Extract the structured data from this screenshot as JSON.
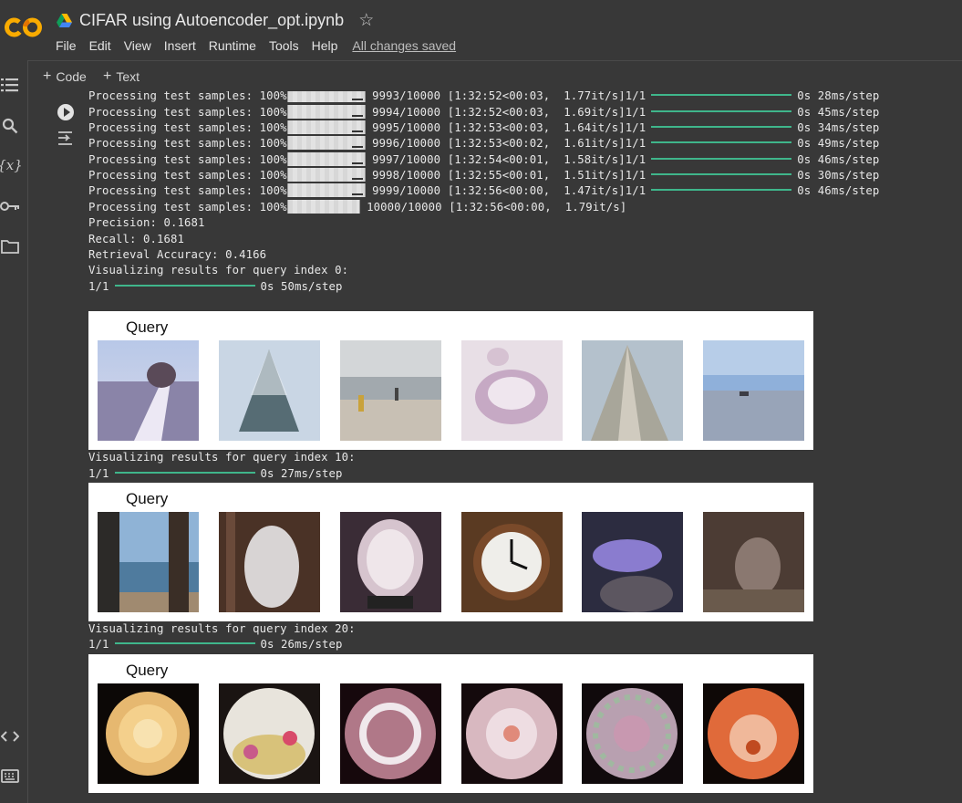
{
  "app": {
    "logo_text": "CO",
    "file_title": "CIFAR using Autoencoder_opt.ipynb",
    "menu": [
      "File",
      "Edit",
      "View",
      "Insert",
      "Runtime",
      "Tools",
      "Help"
    ],
    "save_status": "All changes saved"
  },
  "toolbar": {
    "add_code": "Code",
    "add_text": "Text"
  },
  "left_rail": {
    "variables_label": "{x}"
  },
  "output": {
    "progress_lines": [
      {
        "prefix": "Processing test samples: 100%",
        "count": "9993/10000",
        "timing": "[1:32:52<00:03,  1.77it/s]",
        "batch": "1/1",
        "step": "0s 28ms/step"
      },
      {
        "prefix": "Processing test samples: 100%",
        "count": "9994/10000",
        "timing": "[1:32:52<00:03,  1.69it/s]",
        "batch": "1/1",
        "step": "0s 45ms/step"
      },
      {
        "prefix": "Processing test samples: 100%",
        "count": "9995/10000",
        "timing": "[1:32:53<00:03,  1.64it/s]",
        "batch": "1/1",
        "step": "0s 34ms/step"
      },
      {
        "prefix": "Processing test samples: 100%",
        "count": "9996/10000",
        "timing": "[1:32:53<00:02,  1.61it/s]",
        "batch": "1/1",
        "step": "0s 49ms/step"
      },
      {
        "prefix": "Processing test samples: 100%",
        "count": "9997/10000",
        "timing": "[1:32:54<00:01,  1.58it/s]",
        "batch": "1/1",
        "step": "0s 46ms/step"
      },
      {
        "prefix": "Processing test samples: 100%",
        "count": "9998/10000",
        "timing": "[1:32:55<00:01,  1.51it/s]",
        "batch": "1/1",
        "step": "0s 30ms/step"
      },
      {
        "prefix": "Processing test samples: 100%",
        "count": "9999/10000",
        "timing": "[1:32:56<00:00,  1.47it/s]",
        "batch": "1/1",
        "step": "0s 46ms/step"
      }
    ],
    "final_line": {
      "prefix": "Processing test samples: 100%",
      "count": "10000/10000",
      "timing": "[1:32:56<00:00,  1.79it/s]"
    },
    "precision": "Precision: 0.1681",
    "recall": "Recall: 0.1681",
    "retrieval_accuracy": "Retrieval Accuracy: 0.4166",
    "query_blocks": [
      {
        "heading": "Visualizing results for query index 0:",
        "batch": "1/1",
        "step": "0s 50ms/step",
        "figure_label": "Query",
        "images": [
          "snowy-road",
          "snowy-tree",
          "beach-people",
          "pink-object",
          "skyscraper",
          "seascape"
        ]
      },
      {
        "heading": "Visualizing results for query index 10:",
        "batch": "1/1",
        "step": "0s 27ms/step",
        "figure_label": "Query",
        "images": [
          "lake-trees",
          "white-blob",
          "white-plate",
          "wall-clock",
          "purple-fish",
          "kangaroo"
        ]
      },
      {
        "heading": "Visualizing results for query index 20:",
        "batch": "1/1",
        "step": "0s 26ms/step",
        "figure_label": "Query",
        "images": [
          "yellow-rose",
          "fishbowl",
          "pink-plate",
          "floral-plate",
          "pink-pattern-plate",
          "orange-flower"
        ]
      }
    ]
  },
  "colors": {
    "background": "#383838",
    "keras_progress": "#3fb68b",
    "logo_orange": "#f9ab00"
  }
}
